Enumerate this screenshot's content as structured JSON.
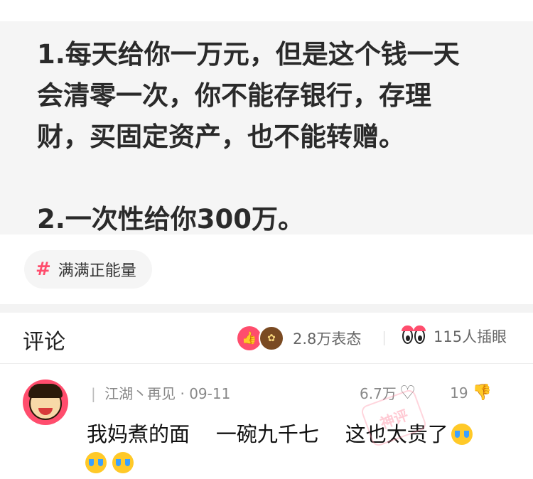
{
  "post": {
    "quote_lines": [
      "1.每天给你一万元，但是这个钱一天",
      "会清零一次，你不能存银行，存理",
      "财，买固定资产，也不能转赠。",
      "2.一次性给你300万。"
    ],
    "topic_tag": "满满正能量"
  },
  "comments_header": {
    "title": "评论",
    "reactions_count": "2.8万表态",
    "poke_count": "115人插眼"
  },
  "comment": {
    "author": "江湖丶再见",
    "separator": "·",
    "date": "09-11",
    "likes": "6.7万",
    "dislikes": "19",
    "text": "我妈煮的面    一碗九千七    这也太贵了",
    "stamp": "神评"
  },
  "colors": {
    "accent": "#ff4d6d",
    "card_bg": "#f5f5f5"
  }
}
